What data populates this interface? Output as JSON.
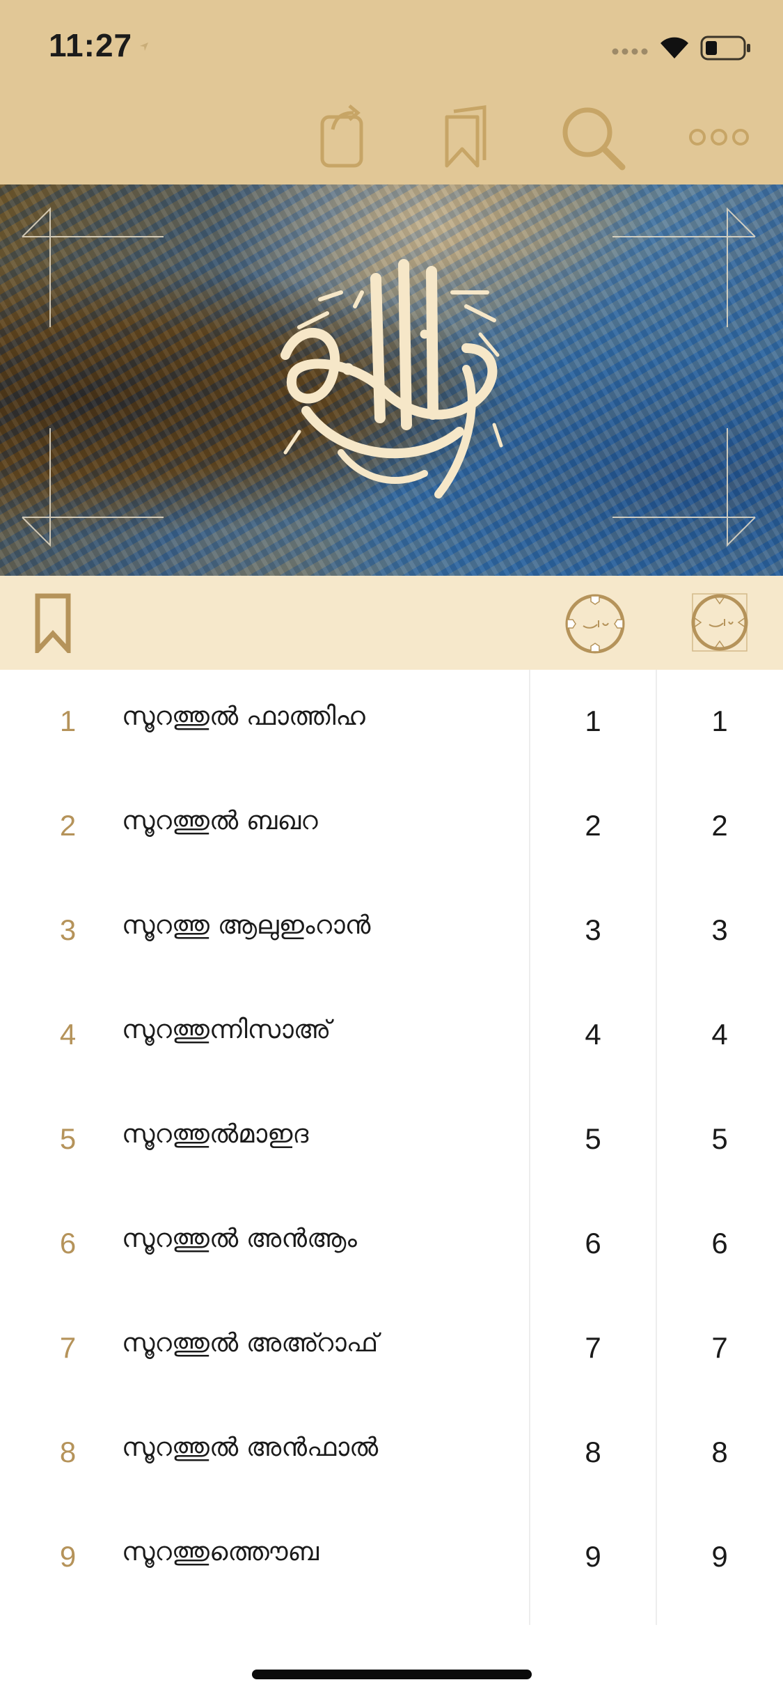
{
  "status_bar": {
    "time": "11:27"
  },
  "toolbar": {
    "icons": [
      "share-icon",
      "bookmarks-icon",
      "search-icon",
      "more-icon"
    ]
  },
  "filter_bar": {
    "icons": [
      "bookmark-icon",
      "juz-icon",
      "hizb-icon"
    ]
  },
  "colors": {
    "header_bg": "#e1c796",
    "filter_bg": "#f6e8cb",
    "accent_gold": "#b5935a",
    "icon_gold": "#c7a566"
  },
  "surahs": [
    {
      "index": "1",
      "name": "സൂറത്തുൽ ഫാത്തിഹ",
      "col1": "1",
      "col2": "1"
    },
    {
      "index": "2",
      "name": "സൂറത്തുൽ ബഖറ",
      "col1": "2",
      "col2": "2"
    },
    {
      "index": "3",
      "name": "സൂറത്തു ആലുഇംറാൻ",
      "col1": "3",
      "col2": "3"
    },
    {
      "index": "4",
      "name": "സൂറത്തുന്നിസാഅ്",
      "col1": "4",
      "col2": "4"
    },
    {
      "index": "5",
      "name": "സൂറത്തുൽമാഇദ",
      "col1": "5",
      "col2": "5"
    },
    {
      "index": "6",
      "name": "സൂറത്തുൽ അൻആം",
      "col1": "6",
      "col2": "6"
    },
    {
      "index": "7",
      "name": "സൂറത്തുൽ അഅ്റാഫ്",
      "col1": "7",
      "col2": "7"
    },
    {
      "index": "8",
      "name": "സൂറത്തുൽ അൻഫാൽ",
      "col1": "8",
      "col2": "8"
    },
    {
      "index": "9",
      "name": "സൂറത്തുത്തൌബ",
      "col1": "9",
      "col2": "9"
    }
  ]
}
